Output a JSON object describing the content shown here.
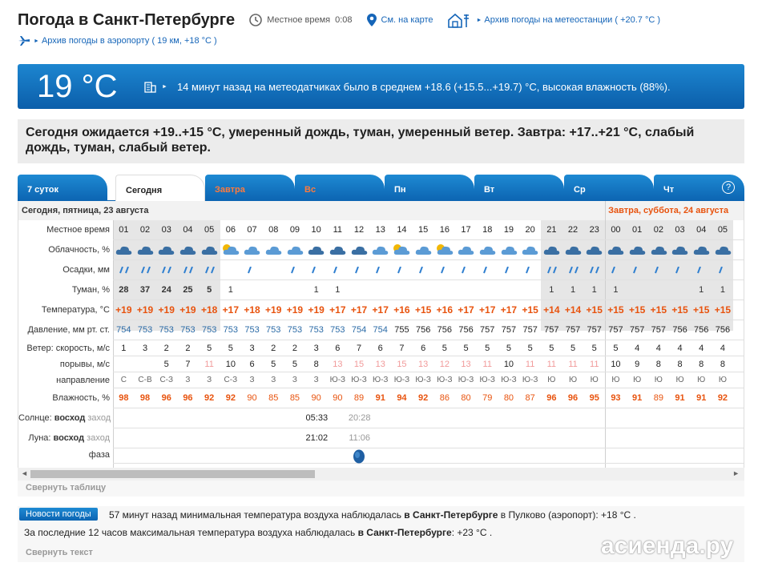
{
  "header": {
    "title": "Погода в Санкт-Петербурге",
    "local_time_label": "Местное время",
    "local_time_value": "0:08",
    "map_link": "См. на карте",
    "station_archive_link": "Архив погоды на метеостанции ( +20.7 °C )",
    "airport_archive_link": "Архив погоды в аэропорту ( 19 км, +18 °C )"
  },
  "current": {
    "temp": "19 °C",
    "summary": "14 минут назад на метеодатчиках было в среднем +18.6 (+15.5...+19.7) °C, высокая влажность (88%)."
  },
  "forecast_text": "Сегодня ожидается +19..+15 °C, умеренный дождь, туман, умеренный ветер. Завтра: +17..+21 °C, слабый дождь, туман, слабый ветер.",
  "tabs": [
    {
      "label": "7 суток",
      "red": false,
      "active": false
    },
    {
      "label": "Сегодня",
      "red": false,
      "active": true
    },
    {
      "label": "Завтра",
      "red": true,
      "active": false
    },
    {
      "label": "Вс",
      "red": true,
      "active": false
    },
    {
      "label": "Пн",
      "red": false,
      "active": false
    },
    {
      "label": "Вт",
      "red": false,
      "active": false
    },
    {
      "label": "Ср",
      "red": false,
      "active": false
    },
    {
      "label": "Чт",
      "red": false,
      "active": false
    }
  ],
  "help_label": "?",
  "days": {
    "today": "Сегодня, пятница, 23 августа",
    "tomorrow": "Завтра, суббота, 24 августа"
  },
  "row_labels": {
    "time": "Местное время",
    "cloud": "Облачность, %",
    "precip": "Осадки, мм",
    "fog": "Туман, %",
    "temp": "Температура, °C",
    "pressure": "Давление, мм рт. ст.",
    "wind_speed": "Ветер: скорость, м/с",
    "gusts": "порывы, м/с",
    "direction": "направление",
    "humidity": "Влажность, %",
    "sun": "Солнце:",
    "sun_rise": "восход",
    "sun_set": "заход",
    "moon": "Луна:",
    "moon_rise": "восход",
    "moon_set": "заход",
    "moon_phase": "фаза"
  },
  "hours": [
    "01",
    "02",
    "03",
    "04",
    "05",
    "06",
    "07",
    "08",
    "09",
    "10",
    "11",
    "12",
    "13",
    "14",
    "15",
    "16",
    "17",
    "18",
    "19",
    "20",
    "21",
    "22",
    "23",
    "00",
    "01",
    "02",
    "03",
    "04",
    "05"
  ],
  "fog": [
    "28",
    "37",
    "24",
    "25",
    "5",
    "1",
    "",
    "",
    "",
    "1",
    "1",
    "",
    "",
    "",
    "",
    "",
    "",
    "",
    "",
    "",
    "1",
    "1",
    "1",
    "1",
    "",
    "",
    "",
    "1",
    "1"
  ],
  "temperature": [
    "+19",
    "+19",
    "+19",
    "+19",
    "+18",
    "+17",
    "+18",
    "+19",
    "+19",
    "+19",
    "+17",
    "+17",
    "+17",
    "+16",
    "+15",
    "+16",
    "+17",
    "+17",
    "+17",
    "+15",
    "+14",
    "+14",
    "+15",
    "+15",
    "+15",
    "+15",
    "+15",
    "+15",
    "+15"
  ],
  "pressure": [
    "754",
    "753",
    "753",
    "753",
    "753",
    "753",
    "753",
    "753",
    "753",
    "753",
    "753",
    "754",
    "754",
    "755",
    "756",
    "756",
    "756",
    "757",
    "757",
    "757",
    "757",
    "757",
    "757",
    "757",
    "757",
    "757",
    "756",
    "756",
    "756"
  ],
  "wind_speed": [
    "1",
    "3",
    "2",
    "2",
    "5",
    "5",
    "3",
    "2",
    "2",
    "3",
    "6",
    "7",
    "6",
    "7",
    "6",
    "5",
    "5",
    "5",
    "5",
    "5",
    "5",
    "5",
    "5",
    "5",
    "4",
    "4",
    "4",
    "4",
    "4"
  ],
  "gusts": [
    "",
    "",
    "5",
    "7",
    "11",
    "10",
    "6",
    "5",
    "5",
    "8",
    "13",
    "15",
    "13",
    "15",
    "13",
    "12",
    "13",
    "11",
    "10",
    "11",
    "11",
    "11",
    "11",
    "10",
    "9",
    "8",
    "8",
    "8",
    "8"
  ],
  "gusts_faded": [
    false,
    false,
    false,
    false,
    true,
    false,
    false,
    false,
    false,
    false,
    true,
    true,
    true,
    true,
    true,
    true,
    true,
    true,
    false,
    true,
    true,
    true,
    true,
    false,
    false,
    false,
    false,
    false,
    false
  ],
  "direction": [
    "С",
    "С-В",
    "С-З",
    "З",
    "З",
    "С-З",
    "З",
    "З",
    "З",
    "З",
    "Ю-З",
    "Ю-З",
    "Ю-З",
    "Ю-З",
    "Ю-З",
    "Ю-З",
    "Ю-З",
    "Ю-З",
    "Ю-З",
    "Ю-З",
    "Ю",
    "Ю",
    "Ю",
    "Ю",
    "Ю",
    "Ю",
    "Ю",
    "Ю",
    "Ю"
  ],
  "humidity": [
    "98",
    "98",
    "96",
    "96",
    "92",
    "92",
    "90",
    "85",
    "85",
    "90",
    "90",
    "89",
    "91",
    "94",
    "92",
    "86",
    "80",
    "79",
    "80",
    "87",
    "96",
    "96",
    "95",
    "93",
    "91",
    "89",
    "91",
    "91",
    "92"
  ],
  "humidity_bold": [
    true,
    true,
    true,
    true,
    true,
    true,
    false,
    false,
    false,
    false,
    false,
    false,
    true,
    true,
    true,
    false,
    false,
    false,
    false,
    false,
    true,
    true,
    true,
    true,
    true,
    false,
    true,
    true,
    true
  ],
  "sun": {
    "rise": "05:33",
    "set": "20:28"
  },
  "moon": {
    "rise": "21:02",
    "set": "11:06"
  },
  "collapse_table": "Свернуть таблицу",
  "news": {
    "badge": "Новости погоды",
    "line1_pre": "57 минут назад минимальная температура воздуха наблюдалась",
    "line1_city": "в Санкт-Петербурге",
    "line1_post": "в Пулково (аэропорт): +18 °C .",
    "line2_pre": "За последние 12 часов максимальная температура воздуха наблюдалась",
    "line2_city": "в Санкт-Петербурге",
    "line2_post": ": +23 °C .",
    "collapse": "Свернуть текст"
  },
  "watermark": "асиенда.ру",
  "colors": {
    "accent": "#0c64b2",
    "warm": "#e8530e",
    "link": "#1565b8"
  }
}
